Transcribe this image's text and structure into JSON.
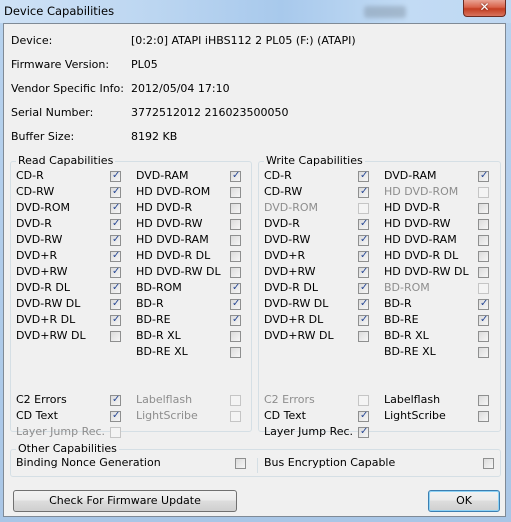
{
  "window": {
    "title": "Device Capabilities",
    "close_icon": "close-x-icon"
  },
  "info": [
    {
      "label": "Device:",
      "value": "[0:2:0] ATAPI iHBS112   2 PL05 (F:) (ATAPI)"
    },
    {
      "label": "Firmware Version:",
      "value": "PL05"
    },
    {
      "label": "Vendor Specific Info:",
      "value": "2012/05/04 17:10"
    },
    {
      "label": "Serial Number:",
      "value": "3772512012 216023500050"
    },
    {
      "label": "Buffer Size:",
      "value": "8192 KB"
    }
  ],
  "read": {
    "title": "Read Capabilities",
    "left": [
      {
        "label": "CD-R",
        "checked": true,
        "enabled": true
      },
      {
        "label": "CD-RW",
        "checked": true,
        "enabled": true
      },
      {
        "label": "DVD-ROM",
        "checked": true,
        "enabled": true
      },
      {
        "label": "DVD-R",
        "checked": true,
        "enabled": true
      },
      {
        "label": "DVD-RW",
        "checked": true,
        "enabled": true
      },
      {
        "label": "DVD+R",
        "checked": true,
        "enabled": true
      },
      {
        "label": "DVD+RW",
        "checked": true,
        "enabled": true
      },
      {
        "label": "DVD-R DL",
        "checked": true,
        "enabled": true
      },
      {
        "label": "DVD-RW DL",
        "checked": true,
        "enabled": true
      },
      {
        "label": "DVD+R DL",
        "checked": true,
        "enabled": true
      },
      {
        "label": "DVD+RW DL",
        "checked": false,
        "enabled": true
      }
    ],
    "right": [
      {
        "label": "DVD-RAM",
        "checked": true,
        "enabled": true
      },
      {
        "label": "HD DVD-ROM",
        "checked": false,
        "enabled": true
      },
      {
        "label": "HD DVD-R",
        "checked": false,
        "enabled": true
      },
      {
        "label": "HD DVD-RW",
        "checked": false,
        "enabled": true
      },
      {
        "label": "HD DVD-RAM",
        "checked": false,
        "enabled": true
      },
      {
        "label": "HD DVD-R DL",
        "checked": false,
        "enabled": true
      },
      {
        "label": "HD DVD-RW DL",
        "checked": false,
        "enabled": true
      },
      {
        "label": "BD-ROM",
        "checked": true,
        "enabled": true
      },
      {
        "label": "BD-R",
        "checked": true,
        "enabled": true
      },
      {
        "label": "BD-RE",
        "checked": true,
        "enabled": true
      },
      {
        "label": "BD-R XL",
        "checked": false,
        "enabled": true
      },
      {
        "label": "BD-RE XL",
        "checked": false,
        "enabled": true
      }
    ],
    "extra_left": [
      {
        "label": "C2 Errors",
        "checked": true,
        "enabled": true
      },
      {
        "label": "CD Text",
        "checked": true,
        "enabled": true
      },
      {
        "label": "Layer Jump Rec.",
        "checked": false,
        "enabled": false
      }
    ],
    "extra_right": [
      {
        "label": "Labelflash",
        "checked": false,
        "enabled": false
      },
      {
        "label": "LightScribe",
        "checked": false,
        "enabled": false
      }
    ]
  },
  "write": {
    "title": "Write Capabilities",
    "left": [
      {
        "label": "CD-R",
        "checked": true,
        "enabled": true
      },
      {
        "label": "CD-RW",
        "checked": true,
        "enabled": true
      },
      {
        "label": "DVD-ROM",
        "checked": false,
        "enabled": false
      },
      {
        "label": "DVD-R",
        "checked": true,
        "enabled": true
      },
      {
        "label": "DVD-RW",
        "checked": true,
        "enabled": true
      },
      {
        "label": "DVD+R",
        "checked": true,
        "enabled": true
      },
      {
        "label": "DVD+RW",
        "checked": true,
        "enabled": true
      },
      {
        "label": "DVD-R DL",
        "checked": true,
        "enabled": true
      },
      {
        "label": "DVD-RW DL",
        "checked": true,
        "enabled": true
      },
      {
        "label": "DVD+R DL",
        "checked": true,
        "enabled": true
      },
      {
        "label": "DVD+RW DL",
        "checked": false,
        "enabled": true
      }
    ],
    "right": [
      {
        "label": "DVD-RAM",
        "checked": true,
        "enabled": true
      },
      {
        "label": "HD DVD-ROM",
        "checked": false,
        "enabled": false
      },
      {
        "label": "HD DVD-R",
        "checked": false,
        "enabled": true
      },
      {
        "label": "HD DVD-RW",
        "checked": false,
        "enabled": true
      },
      {
        "label": "HD DVD-RAM",
        "checked": false,
        "enabled": true
      },
      {
        "label": "HD DVD-R DL",
        "checked": false,
        "enabled": true
      },
      {
        "label": "HD DVD-RW DL",
        "checked": false,
        "enabled": true
      },
      {
        "label": "BD-ROM",
        "checked": false,
        "enabled": false
      },
      {
        "label": "BD-R",
        "checked": true,
        "enabled": true
      },
      {
        "label": "BD-RE",
        "checked": true,
        "enabled": true
      },
      {
        "label": "BD-R XL",
        "checked": false,
        "enabled": true
      },
      {
        "label": "BD-RE XL",
        "checked": false,
        "enabled": true
      }
    ],
    "extra_left": [
      {
        "label": "C2 Errors",
        "checked": false,
        "enabled": false
      },
      {
        "label": "CD Text",
        "checked": true,
        "enabled": true
      },
      {
        "label": "Layer Jump Rec.",
        "checked": true,
        "enabled": true
      }
    ],
    "extra_right": [
      {
        "label": "Labelflash",
        "checked": false,
        "enabled": true
      },
      {
        "label": "LightScribe",
        "checked": false,
        "enabled": true
      }
    ]
  },
  "other": {
    "title": "Other Capabilities",
    "items": [
      {
        "label": "Binding Nonce Generation",
        "checked": false,
        "enabled": true
      },
      {
        "label": "Bus Encryption Capable",
        "checked": false,
        "enabled": true
      }
    ]
  },
  "buttons": {
    "firmware": "Check For Firmware Update",
    "ok": "OK"
  },
  "icons": {
    "check_glyph": "✓"
  }
}
